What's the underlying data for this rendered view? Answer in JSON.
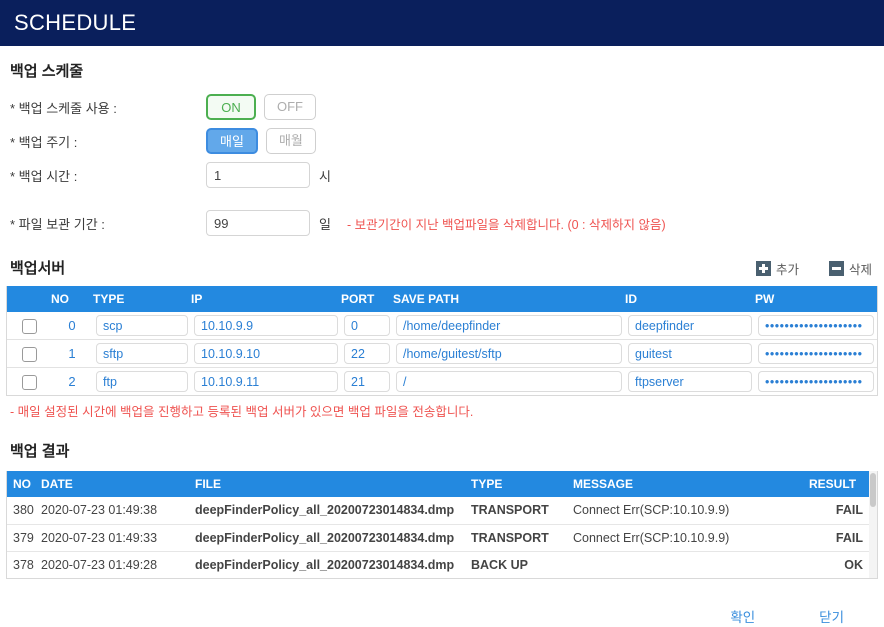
{
  "header": {
    "title": "SCHEDULE"
  },
  "schedule": {
    "section_title": "백업 스케줄",
    "rows": {
      "use": {
        "label": "* 백업 스케줄 사용 :",
        "on_label": "ON",
        "off_label": "OFF",
        "selected": "ON"
      },
      "cycle": {
        "label": "* 백업 주기 :",
        "daily_label": "매일",
        "monthly_label": "매월",
        "selected": "매일"
      },
      "time": {
        "label": "* 백업 시간 :",
        "value": "1",
        "unit": "시"
      },
      "retention": {
        "label": "* 파일 보관 기간 :",
        "value": "99",
        "unit": "일",
        "hint": "- 보관기간이 지난 백업파일을 삭제합니다. (0 : 삭제하지 않음)"
      }
    }
  },
  "server": {
    "section_title": "백업서버",
    "add_label": "추가",
    "delete_label": "삭제",
    "columns": [
      "",
      "NO",
      "TYPE",
      "IP",
      "PORT",
      "SAVE PATH",
      "ID",
      "PW"
    ],
    "rows": [
      {
        "no": "0",
        "type": "scp",
        "ip": "10.10.9.9",
        "port": "0",
        "path": "/home/deepfinder",
        "id": "deepfinder",
        "pw": "••••••••••••••••••••"
      },
      {
        "no": "1",
        "type": "sftp",
        "ip": "10.10.9.10",
        "port": "22",
        "path": "/home/guitest/sftp",
        "id": "guitest",
        "pw": "••••••••••••••••••••"
      },
      {
        "no": "2",
        "type": "ftp",
        "ip": "10.10.9.11",
        "port": "21",
        "path": "/",
        "id": "ftpserver",
        "pw": "••••••••••••••••••••"
      }
    ],
    "note": "- 매일 설정된 시간에 백업을 진행하고 등록된 백업 서버가 있으면 백업 파일을 전송합니다."
  },
  "result": {
    "section_title": "백업 결과",
    "columns": [
      "NO",
      "DATE",
      "FILE",
      "TYPE",
      "MESSAGE",
      "RESULT"
    ],
    "rows": [
      {
        "no": "380",
        "date": "2020-07-23 01:49:38",
        "file": "deepFinderPolicy_all_20200723014834.dmp",
        "type": "TRANSPORT",
        "message": "Connect Err(SCP:10.10.9.9)",
        "result": "FAIL"
      },
      {
        "no": "379",
        "date": "2020-07-23 01:49:33",
        "file": "deepFinderPolicy_all_20200723014834.dmp",
        "type": "TRANSPORT",
        "message": "Connect Err(SCP:10.10.9.9)",
        "result": "FAIL"
      },
      {
        "no": "378",
        "date": "2020-07-23 01:49:28",
        "file": "deepFinderPolicy_all_20200723014834.dmp",
        "type": "BACK UP",
        "message": "",
        "result": "OK"
      }
    ]
  },
  "footer": {
    "confirm_label": "확인",
    "close_label": "닫기"
  },
  "colors": {
    "header_bg": "#0a1f5c",
    "table_header_bg": "#2389e0",
    "accent_blue": "#2a7fd4",
    "warn_red": "#ef5350",
    "fail_red": "#f4392e",
    "ok_green": "#1faa3c",
    "on_green": "#4caf50"
  }
}
